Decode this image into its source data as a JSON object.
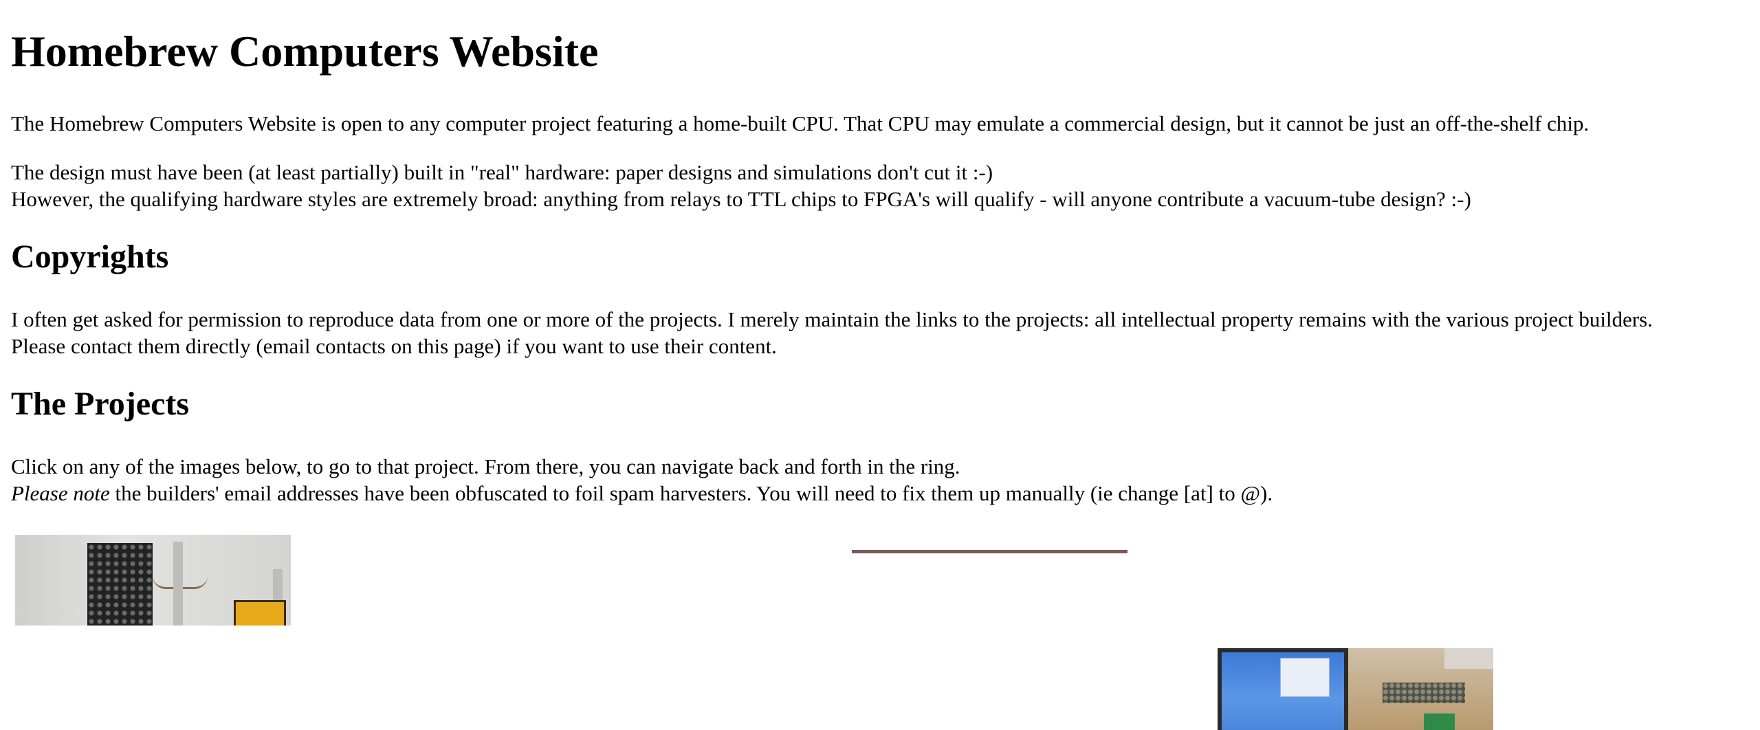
{
  "page": {
    "title": "Homebrew Computers Website",
    "intro": "The Homebrew Computers Website is open to any computer project featuring a home-built CPU. That CPU may emulate a commercial design, but it cannot be just an off-the-shelf chip.",
    "requirements_line1": "The design must have been (at least partially) built in \"real\" hardware: paper designs and simulations don't cut it :-)",
    "requirements_line2": "However, the qualifying hardware styles are extremely broad: anything from relays to TTL chips to FPGA's will qualify - will anyone contribute a vacuum-tube design? :-)"
  },
  "copyrights": {
    "heading": "Copyrights",
    "line1": "I often get asked for permission to reproduce data from one or more of the projects. I merely maintain the links to the projects: all intellectual property remains with the various project builders.",
    "line2": "Please contact them directly (email contacts on this page) if you want to use their content."
  },
  "projects": {
    "heading": "The Projects",
    "line1": "Click on any of the images below, to go to that project. From there, you can navigate back and forth in the ring.",
    "note_label": "Please note",
    "note_text": " the builders' email addresses have been obfuscated to foil spam harvesters. You will need to fix them up manually (ie change [at] to @)."
  }
}
